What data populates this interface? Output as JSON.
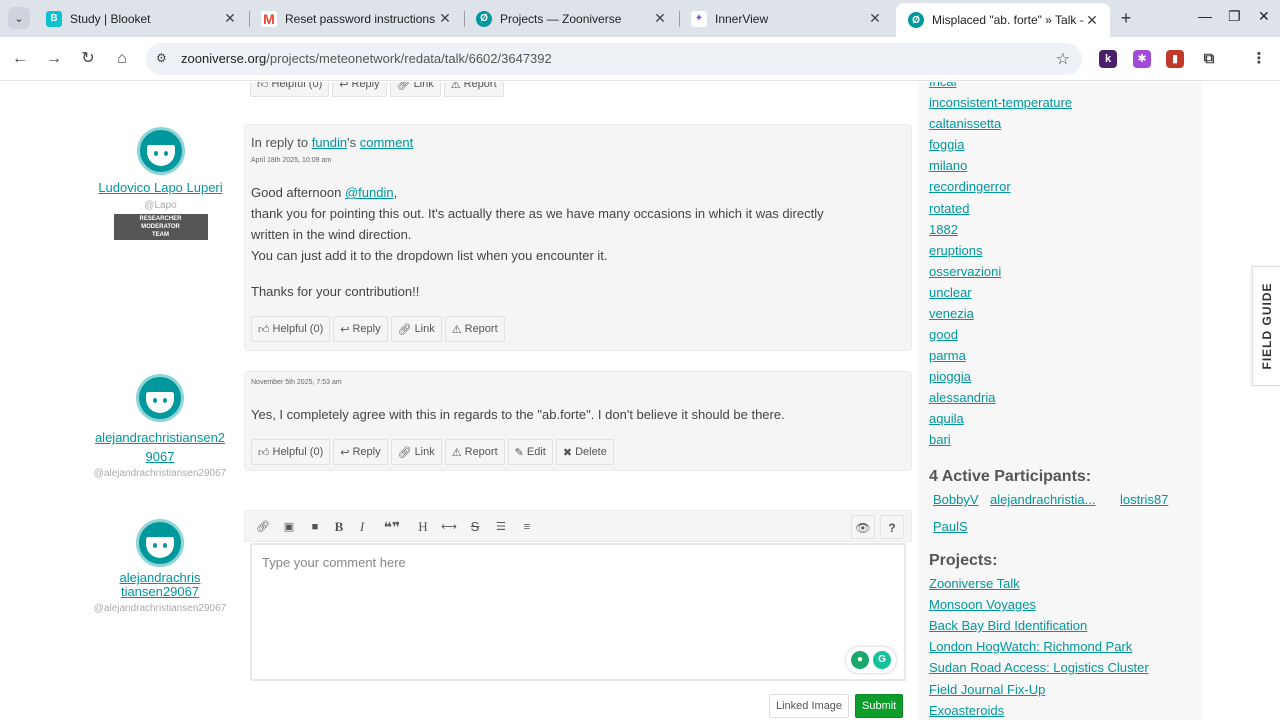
{
  "browser": {
    "tabs": [
      {
        "title": "Study | Blooket",
        "fav_color": "#0bc2cf",
        "fav_glyph": "B"
      },
      {
        "title": "Reset password instructions - ",
        "fav_color": "#ffffff",
        "fav_glyph": "M"
      },
      {
        "title": "Projects — Zooniverse",
        "fav_color": "#00979d",
        "fav_glyph": "Ø"
      },
      {
        "title": "InnerView",
        "fav_color": "#7b4bd6",
        "fav_glyph": "✦"
      },
      {
        "title": "Misplaced \"ab. forte\" » Talk - ",
        "fav_color": "#00979d",
        "fav_glyph": "Ø"
      }
    ],
    "url_host": "zooniverse.org",
    "url_path": "/projects/meteonetwork/redata/talk/6602/3647392"
  },
  "actions": {
    "helpful": "Helpful (0)",
    "reply": "Reply",
    "link": "Link",
    "report": "Report",
    "edit": "Edit",
    "delete": "Delete"
  },
  "comments": [
    {
      "author": "Ludovico Lapo Luperi",
      "handle": "@Lapo",
      "roles": [
        "RESEARCHER",
        "MODERATOR",
        "TEAM"
      ],
      "reply_prefix": "In reply to",
      "reply_user": "fundin",
      "reply_mid": "'s",
      "reply_target": "comment",
      "date": "April 18th 2025, 10:09 am",
      "greeting": "Good afternoon",
      "mention": "@fundin",
      "lines": [
        "thank you for pointing this out. It's actually there as we have many occasions in which it was directly",
        "written in the wind direction.",
        "You can just add it to the dropdown list when you encounter it."
      ],
      "closing": "Thanks for your contribution!!"
    },
    {
      "author_line1": "alejandrachristiansen2",
      "author_line2": "9067",
      "handle": "@alejandrachristiansen29067",
      "date": "November 5th 2025, 7:53 am",
      "text": "Yes, I completely agree with this in regards to the \"ab.forte\". I don't believe it should be there."
    }
  ],
  "composer": {
    "author_line1": "alejandrachris",
    "author_line2": "tiansen29067",
    "handle": "@alejandrachristiansen29067",
    "placeholder": "Type your comment here",
    "linked_image": "Linked Image",
    "submit": "Submit"
  },
  "sidebar": {
    "partial_top_tag": "fncal",
    "tags": [
      "inconsistent-temperature",
      "caltanissetta",
      "foggia",
      "milano",
      "recordingerror",
      "rotated",
      "1882",
      "eruptions",
      "osservazioni",
      "unclear",
      "venezia",
      "good",
      "parma",
      "pioggia",
      "alessandria",
      "aquila",
      "bari"
    ],
    "participants_heading": "4 Active Participants:",
    "participants": [
      "BobbyV",
      "alejandrachristia...",
      "lostris87",
      "PaulS"
    ],
    "projects_heading": "Projects:",
    "projects": [
      "Zooniverse Talk",
      "Monsoon Voyages",
      "Back Bay Bird Identification",
      "London HogWatch: Richmond Park ",
      "Sudan Road Access: Logistics Cluster",
      "Field Journal Fix-Up",
      "Exoasteroids"
    ]
  },
  "field_guide": "FIELD GUIDE",
  "colors": {
    "accent": "#00979d",
    "submit": "#0c9d2b"
  }
}
